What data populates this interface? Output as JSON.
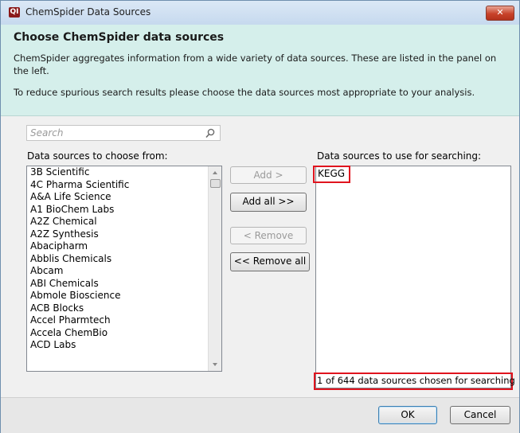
{
  "window": {
    "title": "ChemSpider Data Sources",
    "close_glyph": "✕",
    "app_icon_text": "QI"
  },
  "header": {
    "title": "Choose ChemSpider data sources",
    "desc1": "ChemSpider aggregates information from a wide variety of data sources. These are listed in the panel on the left.",
    "desc2": "To reduce spurious search results please choose the data sources most appropriate to your analysis."
  },
  "search": {
    "placeholder": "Search"
  },
  "left": {
    "label": "Data sources to choose from:",
    "items": [
      "3B Scientific",
      "4C Pharma Scientific",
      "A&A Life Science",
      "A1 BioChem Labs",
      "A2Z Chemical",
      "A2Z Synthesis",
      "Abacipharm",
      "Abblis Chemicals",
      "Abcam",
      "ABI Chemicals",
      "Abmole Bioscience",
      "ACB Blocks",
      "Accel Pharmtech",
      "Accela ChemBio",
      "ACD Labs"
    ]
  },
  "buttons": {
    "add": "Add >",
    "add_all": "Add all >>",
    "remove": "< Remove",
    "remove_all": "<< Remove all",
    "ok": "OK",
    "cancel": "Cancel"
  },
  "right": {
    "label": "Data sources to use for searching:",
    "items": [
      "KEGG"
    ],
    "status": "1 of 644 data sources chosen for searching"
  },
  "colors": {
    "highlight": "#e0141e",
    "header_bg": "#d5efeb"
  }
}
